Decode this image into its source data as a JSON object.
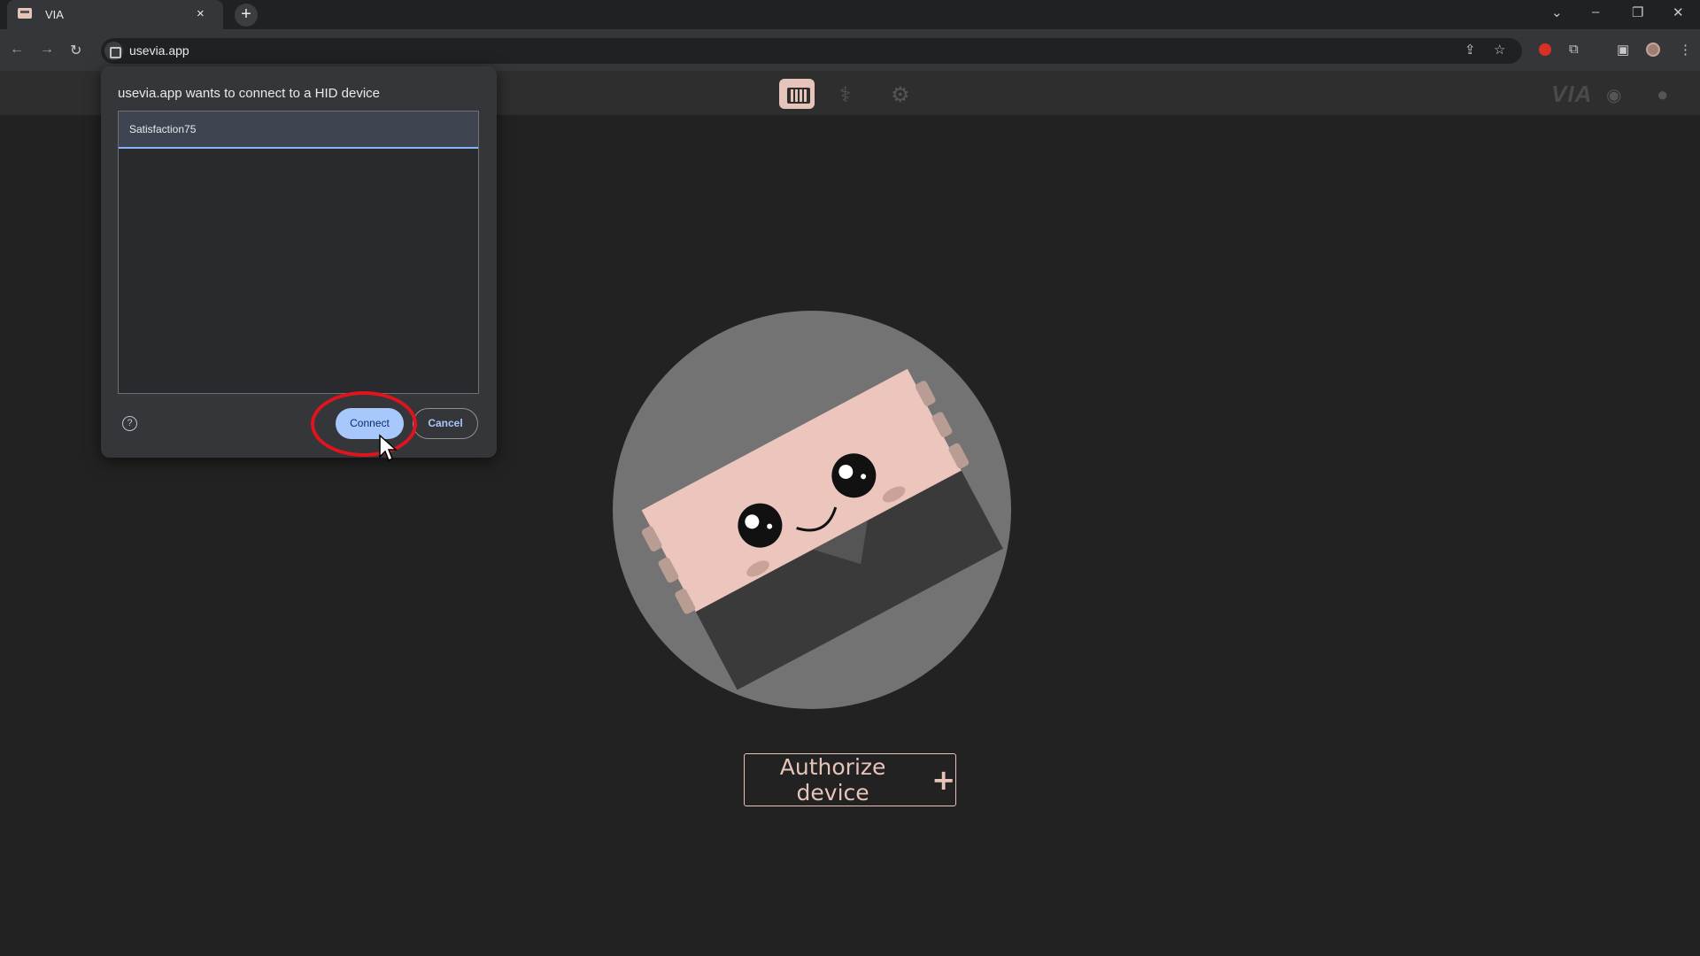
{
  "browser": {
    "tab_title": "VIA",
    "tab_close": "×",
    "new_tab": "+",
    "url": "usevia.app",
    "window_controls": [
      "⌄",
      "–",
      "❐",
      "✕"
    ]
  },
  "app": {
    "name": "VIA",
    "nav_icons": [
      "keyboard-icon",
      "stethoscope-icon",
      "gear-icon"
    ],
    "header_links": [
      "via-logo",
      "discord-icon",
      "github-icon"
    ],
    "authorize_label": "Authorize device",
    "authorize_plus": "+",
    "accent_color": "#e7c4b9"
  },
  "hid_dialog": {
    "title": "usevia.app wants to connect to a HID device",
    "devices": [
      "Satisfaction75"
    ],
    "selected_device": "Satisfaction75",
    "help": "?",
    "connect_label": "Connect",
    "cancel_label": "Cancel"
  }
}
